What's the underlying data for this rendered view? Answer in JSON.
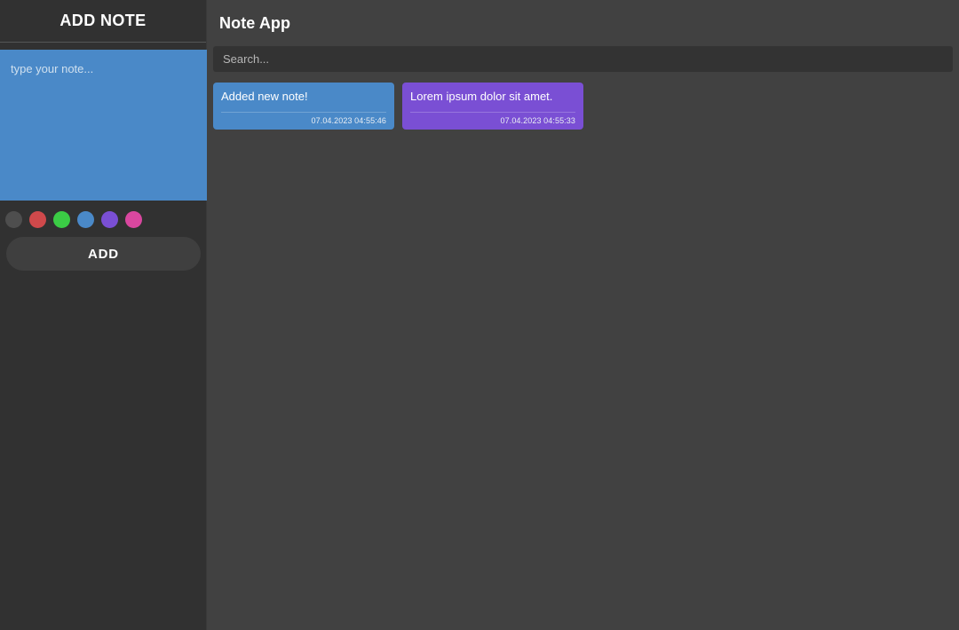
{
  "sidebar": {
    "title": "ADD NOTE",
    "note_input": {
      "value": "",
      "placeholder": "type your note...",
      "background": "#4a89c8"
    },
    "colors": [
      {
        "name": "gray",
        "hex": "#4e4e4e"
      },
      {
        "name": "red",
        "hex": "#d0494b"
      },
      {
        "name": "green",
        "hex": "#3bcc45"
      },
      {
        "name": "blue",
        "hex": "#4a89c8"
      },
      {
        "name": "purple",
        "hex": "#7a4fd4"
      },
      {
        "name": "pink",
        "hex": "#d9479f"
      }
    ],
    "add_label": "ADD"
  },
  "main": {
    "title": "Note App",
    "search": {
      "value": "",
      "placeholder": "Search..."
    },
    "notes": [
      {
        "text": "Added new note!",
        "date": "07.04.2023 04:55:46",
        "color": "#4a89c8"
      },
      {
        "text": "Lorem ipsum dolor sit amet.",
        "date": "07.04.2023 04:55:33",
        "color": "#7a4fd4"
      }
    ]
  }
}
